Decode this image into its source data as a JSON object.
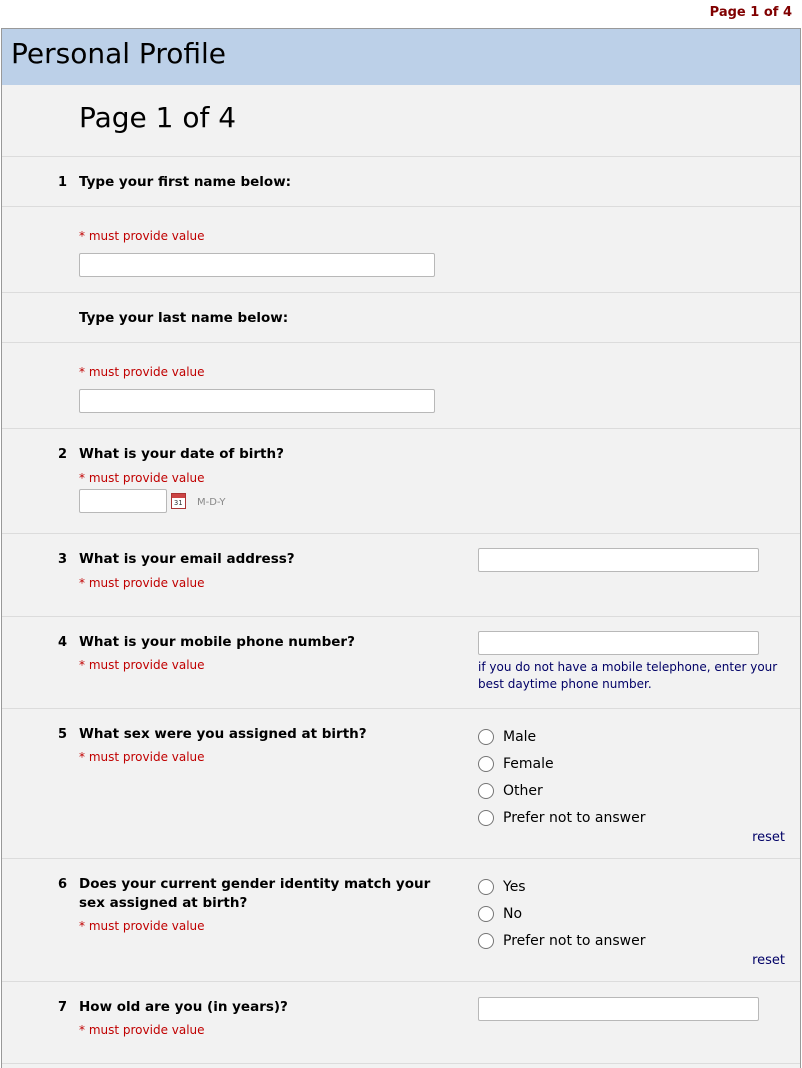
{
  "top_indicator": "Page 1 of 4",
  "survey_title": "Personal Profile",
  "page_heading": "Page 1 of 4",
  "required_text": "* must provide value",
  "questions": [
    {
      "num": "1",
      "text": "Type your first name below:"
    },
    {
      "num": "",
      "text": "Type your last name below:"
    },
    {
      "num": "2",
      "text": "What is your date of birth?",
      "date_format": "M-D-Y",
      "calendar_icon": "31"
    },
    {
      "num": "3",
      "text": "What is your email address?"
    },
    {
      "num": "4",
      "text": "What is your mobile phone number?",
      "note": "if you do not have a mobile telephone, enter your best daytime phone number."
    },
    {
      "num": "5",
      "text": "What sex were you assigned at birth?",
      "options": [
        "Male",
        "Female",
        "Other",
        "Prefer not to answer"
      ],
      "reset": "reset"
    },
    {
      "num": "6",
      "text": "Does your current gender identity match your sex assigned at birth?",
      "options": [
        "Yes",
        "No",
        "Prefer not to answer"
      ],
      "reset": "reset"
    },
    {
      "num": "7",
      "text": "How old are you (in years)?"
    }
  ],
  "colors": {
    "title_bar": "#bcd0e8",
    "required": "#c00000",
    "page_indicator": "#800000",
    "link": "#000066"
  }
}
